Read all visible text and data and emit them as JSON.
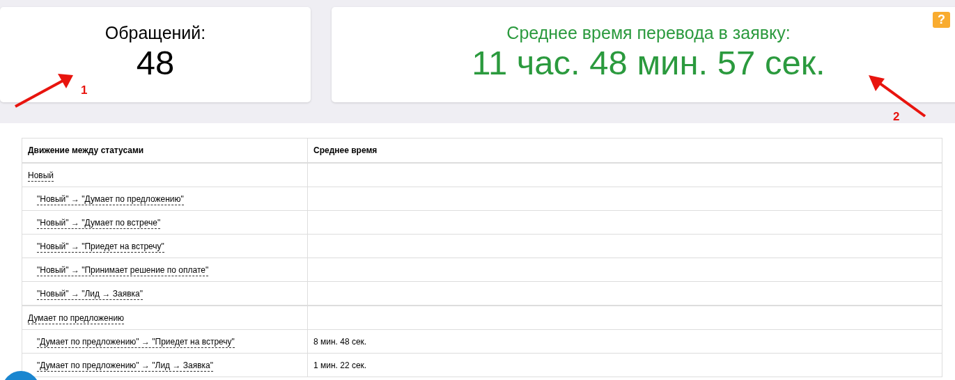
{
  "stats": [
    {
      "kind": "plain",
      "title": "Обращений:",
      "value": "48"
    },
    {
      "kind": "accent",
      "title": "Среднее время перевода в заявку:",
      "value": "11 час. 48 мин. 57 сек.",
      "help": "?"
    }
  ],
  "annotations": [
    {
      "number": "1"
    },
    {
      "number": "2"
    }
  ],
  "table": {
    "columns": [
      "Движение между статусами",
      "Среднее время"
    ],
    "groups": [
      {
        "label": "Новый",
        "children": [
          {
            "label": "\"Новый\" → \"Думает по предложению\""
          },
          {
            "label": "\"Новый\" → \"Думает по встрече\""
          },
          {
            "label": "\"Новый\" → \"Приедет на встречу\""
          },
          {
            "label": "\"Новый\" → \"Принимает решение по оплате\""
          },
          {
            "label": "\"Новый\" → \"Лид → Заявка\""
          }
        ]
      },
      {
        "label": "Думает по предложению",
        "children": [
          {
            "label": "\"Думает по предложению\" → \"Приедет на встречу\"",
            "time": "8 мин. 48 сек."
          },
          {
            "label": "\"Думает по предложению\" → \"Лид → Заявка\"",
            "time": "1 мин. 22 сек."
          }
        ]
      }
    ]
  }
}
